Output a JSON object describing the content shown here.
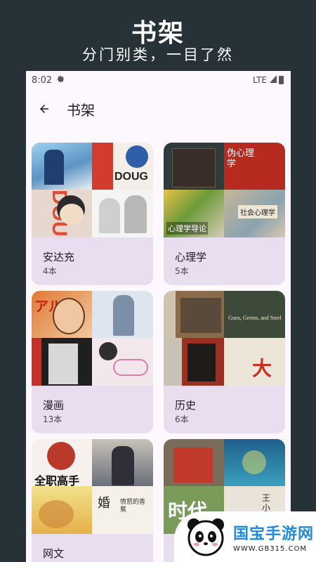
{
  "promo": {
    "title": "书架",
    "subtitle": "分门别类，一目了然"
  },
  "status_bar": {
    "time": "8:02",
    "network": "LTE"
  },
  "app_bar": {
    "title": "书架",
    "back_icon": "arrow-left-icon"
  },
  "shelves": [
    {
      "name": "安达充",
      "count": "4本",
      "covers": [
        "#7fb1d8",
        "#2a5a9e",
        "#f1e6d0",
        "#e9eef2"
      ]
    },
    {
      "name": "心理学",
      "count": "5本",
      "covers": [
        "#3a2f2a",
        "#b22a22",
        "#6a8a3c",
        "#c9b59a"
      ]
    },
    {
      "name": "漫画",
      "count": "13本",
      "covers": [
        "#d96d2c",
        "#d8e3ec",
        "#2a2a2a",
        "#e8dfe2"
      ]
    },
    {
      "name": "历史",
      "count": "6本",
      "covers": [
        "#8a6b4a",
        "#3d4a3a",
        "#9a2f22",
        "#e7ded0"
      ]
    },
    {
      "name": "网文",
      "count": "",
      "covers": [
        "#c83a2a",
        "#6a6f7c",
        "#e8c95a",
        "#f3efe6"
      ]
    },
    {
      "name": "",
      "count": "",
      "covers": [
        "#1f5f8a",
        "#4f8fa6",
        "#c23a22",
        "#e9e3da"
      ]
    }
  ],
  "overlay_text": {
    "cover_dough": "DOUG",
    "cover_dough2": "DOUG",
    "cover_psych1": "伪心理学",
    "cover_psych2": "心理学导论",
    "cover_psych3": "社会心理学",
    "cover_anime": "アル",
    "cover_hist1": "Guns, Germs, and Steel",
    "cover_hist2": "大明",
    "cover_web1": "全职高手",
    "cover_web2": "婚",
    "cover_web3": "愤怒的香蕉",
    "cover_web4": "时代",
    "cover_web5": "王小波"
  },
  "watermark": {
    "brand": "国宝手游网",
    "url": "WWW.GB315.COM"
  },
  "colors": {
    "background": "#263238",
    "screen": "#fdf8fd",
    "card": "#e8def0",
    "brand": "#1f8bd9"
  }
}
